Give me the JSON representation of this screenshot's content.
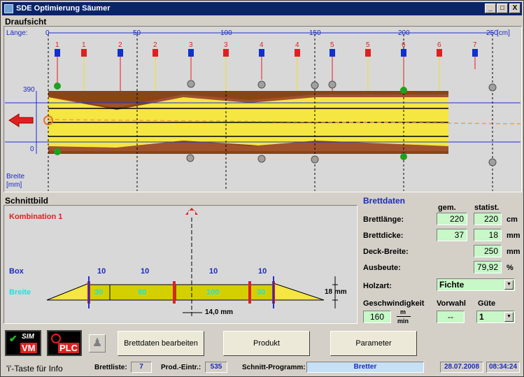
{
  "window": {
    "title": "SDE Optimierung Säumer",
    "minimize": "_",
    "maximize": "□",
    "close": "X"
  },
  "draufsicht": {
    "title": "Draufsicht",
    "laenge_label": "Länge:",
    "scale_ticks": [
      "0",
      "50",
      "100",
      "150",
      "200",
      "250"
    ],
    "scale_unit": "[cm]",
    "y_top": "390",
    "y_bottom": "0",
    "breite_label": "Breite",
    "breite_unit": "[mm]",
    "sensor_numbers": [
      "1",
      "1",
      "2",
      "2",
      "3",
      "3",
      "4",
      "4",
      "5",
      "5",
      "6",
      "6",
      "7"
    ]
  },
  "schnittbild": {
    "title": "Schnittbild",
    "kombination": "Kombination 1",
    "box_label": "Box",
    "breite_label": "Breite",
    "box_values": [
      "10",
      "10",
      "10",
      "10"
    ],
    "segment_values": [
      "30",
      "80",
      "100",
      "30"
    ],
    "thickness": "18 mm",
    "offset": "14,0 mm"
  },
  "brettdaten": {
    "title": "Brettdaten",
    "col_gem": "gem.",
    "col_statist": "statist.",
    "brettlaenge_label": "Brettlänge:",
    "brettlaenge_gem": "220",
    "brettlaenge_stat": "220",
    "brettlaenge_unit": "cm",
    "brettdicke_label": "Brettdicke:",
    "brettdicke_gem": "37",
    "brettdicke_stat": "18",
    "brettdicke_unit": "mm",
    "deckbreite_label": "Deck-Breite:",
    "deckbreite_stat": "250",
    "deckbreite_unit": "mm",
    "ausbeute_label": "Ausbeute:",
    "ausbeute_stat": "79,92",
    "ausbeute_unit": "%",
    "holzart_label": "Holzart:",
    "holzart_value": "Fichte",
    "geschwindigkeit_label": "Geschwindigkeit",
    "geschwindigkeit_value": "160",
    "geschwindigkeit_unit_top": "m",
    "geschwindigkeit_unit_bottom": "min",
    "vorwahl_label": "Vorwahl",
    "vorwahl_value": "--",
    "guete_label": "Güte",
    "guete_value": "1"
  },
  "toolbar": {
    "sim_label": "SIM",
    "vm_label": "VM",
    "plc_label": "PLC",
    "brettdaten_button": "Brettdaten bearbeiten",
    "produkt_button": "Produkt",
    "parameter_button": "Parameter"
  },
  "status": {
    "info": "'i'-Taste für Info",
    "brettliste_label": "Brettliste:",
    "brettliste_value": "7",
    "prod_label": "Prod.-Eintr.:",
    "prod_value": "535",
    "schnitt_label": "Schnitt-Programm:",
    "schnitt_value": "Bretter",
    "date": "28.07.2008",
    "time": "08:34:24"
  },
  "colors": {
    "wood_brown": "#8b4513",
    "wood_yellow": "#f5e642",
    "green_field": "#c8f7c8",
    "accent_blue": "#1a2bbf",
    "sensor_red": "#e02020",
    "sensor_blue": "#1030d0"
  }
}
